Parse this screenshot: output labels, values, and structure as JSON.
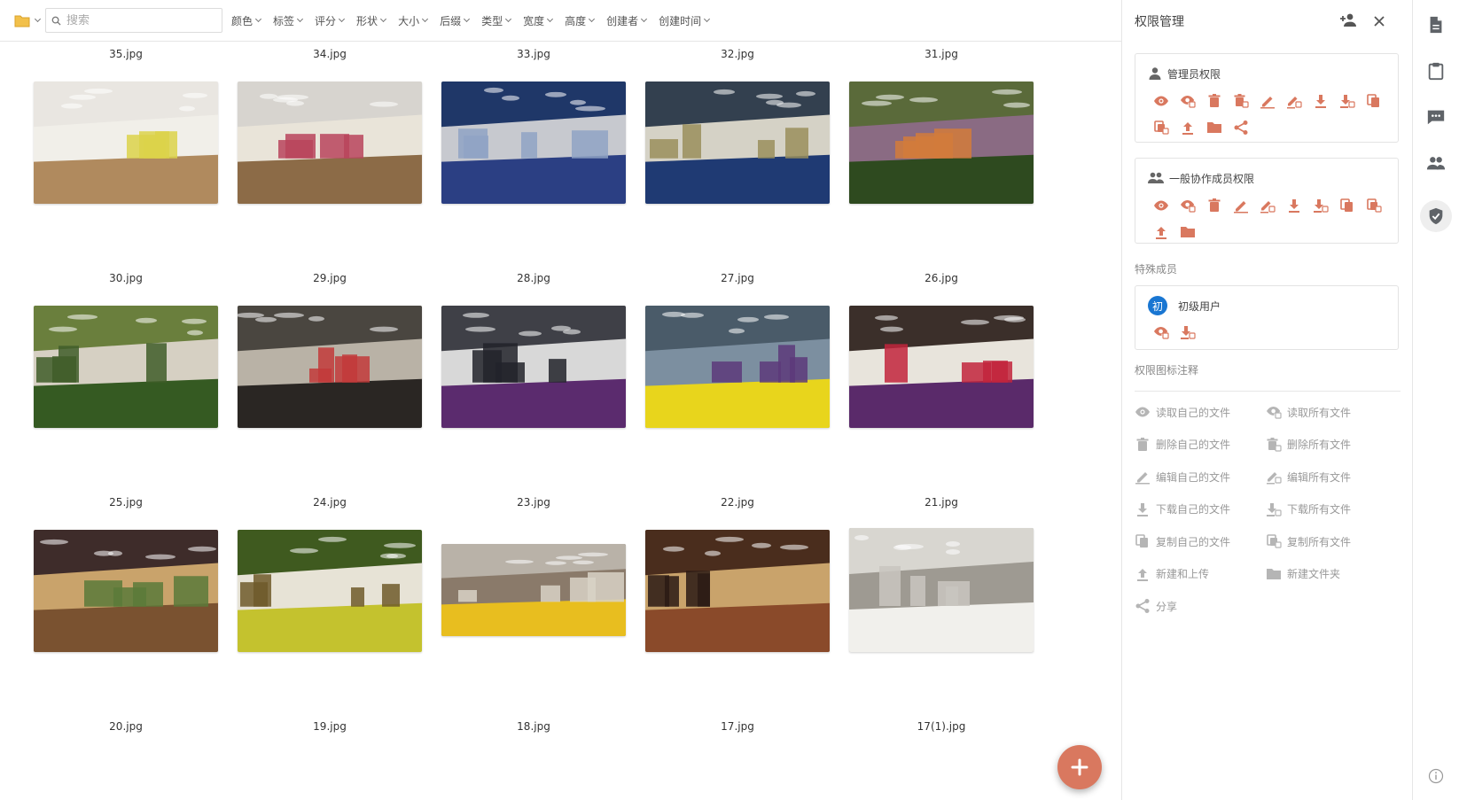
{
  "toolbar": {
    "search_placeholder": "搜索",
    "filters": [
      "颜色",
      "标签",
      "评分",
      "形状",
      "大小",
      "后缀",
      "类型",
      "宽度",
      "高度",
      "创建者",
      "创建时间"
    ]
  },
  "gallery": {
    "top_row_names": [
      "35.jpg",
      "34.jpg",
      "33.jpg",
      "32.jpg",
      "31.jpg"
    ],
    "rows": [
      {
        "items": [
          {
            "name": "30.jpg",
            "colors": [
              "#e9e6e1",
              "#b08a5e",
              "#f1efe9",
              "#dcd24a"
            ]
          },
          {
            "name": "29.jpg",
            "colors": [
              "#d7d4cf",
              "#8c6b47",
              "#e9e4d9",
              "#b8445c"
            ]
          },
          {
            "name": "28.jpg",
            "colors": [
              "#1f3768",
              "#2b3f83",
              "#c7c9cf",
              "#8fa3c4"
            ]
          },
          {
            "name": "27.jpg",
            "colors": [
              "#33404f",
              "#1f3a73",
              "#d5d2c6",
              "#9a8f5c"
            ]
          },
          {
            "name": "26.jpg",
            "colors": [
              "#5a6a3a",
              "#2e4a1f",
              "#8a6b83",
              "#d27b3b"
            ]
          }
        ]
      },
      {
        "items": [
          {
            "name": "25.jpg",
            "colors": [
              "#6a7f3d",
              "#355a22",
              "#d6d0c3",
              "#3f5d29"
            ]
          },
          {
            "name": "24.jpg",
            "colors": [
              "#4a4640",
              "#2a2623",
              "#b9b2a6",
              "#c23a3a"
            ]
          },
          {
            "name": "23.jpg",
            "colors": [
              "#3f4047",
              "#5b2b6e",
              "#d8d8d8",
              "#22232a"
            ]
          },
          {
            "name": "22.jpg",
            "colors": [
              "#4a5b69",
              "#e8d51c",
              "#7c8fa0",
              "#5d3a7a"
            ]
          },
          {
            "name": "21.jpg",
            "colors": [
              "#3b2f2a",
              "#5a2a6a",
              "#e8e4dc",
              "#c2243c"
            ]
          }
        ]
      },
      {
        "items": [
          {
            "name": "20.jpg",
            "colors": [
              "#3e2c2a",
              "#7a5230",
              "#c9a36b",
              "#5b7a3a"
            ]
          },
          {
            "name": "19.jpg",
            "colors": [
              "#3f5a1f",
              "#c4c22e",
              "#e7e3d6",
              "#6f5a2a"
            ]
          },
          {
            "name": "18.jpg",
            "colors": [
              "#b9b2a8",
              "#e8be1f",
              "#8a7a6a",
              "#d8d2c6"
            ]
          },
          {
            "name": "17.jpg",
            "colors": [
              "#4a2d1d",
              "#8a4a2a",
              "#c9a36b",
              "#2a1a14"
            ]
          },
          {
            "name": "17(1).jpg",
            "colors": [
              "#d8d6d0",
              "#f1f0ec",
              "#9e9a92",
              "#c9c6bf"
            ]
          }
        ]
      }
    ]
  },
  "panel": {
    "title": "权限管理",
    "admin": {
      "title": "管理员权限",
      "icons": [
        "eye-icon",
        "eye-all-icon",
        "trash-icon",
        "trash-all-icon",
        "pencil-icon",
        "pencil-all-icon",
        "download-icon",
        "download-all-icon",
        "copy-icon",
        "copy-all-icon",
        "upload-icon",
        "folder-icon",
        "share-icon"
      ]
    },
    "member": {
      "title": "一般协作成员权限",
      "icons": [
        "eye-icon",
        "eye-all-icon",
        "trash-icon",
        "pencil-icon",
        "pencil-all-icon",
        "download-icon",
        "download-all-icon",
        "copy-icon",
        "copy-all-icon",
        "upload-icon",
        "folder-icon"
      ]
    },
    "special_label": "特殊成员",
    "special_member": {
      "avatar_char": "初",
      "name": "初级用户",
      "icons": [
        "eye-all-icon",
        "download-all-icon"
      ]
    },
    "legend_label": "权限图标注释",
    "legend": [
      {
        "icon": "eye-icon",
        "label": "读取自己的文件"
      },
      {
        "icon": "eye-all-icon",
        "label": "读取所有文件"
      },
      {
        "icon": "trash-icon",
        "label": "删除自己的文件"
      },
      {
        "icon": "trash-all-icon",
        "label": "删除所有文件"
      },
      {
        "icon": "pencil-icon",
        "label": "编辑自己的文件"
      },
      {
        "icon": "pencil-all-icon",
        "label": "编辑所有文件"
      },
      {
        "icon": "download-icon",
        "label": "下载自己的文件"
      },
      {
        "icon": "download-all-icon",
        "label": "下载所有文件"
      },
      {
        "icon": "copy-icon",
        "label": "复制自己的文件"
      },
      {
        "icon": "copy-all-icon",
        "label": "复制所有文件"
      },
      {
        "icon": "upload-icon",
        "label": "新建和上传"
      },
      {
        "icon": "folder-icon",
        "label": "新建文件夹"
      },
      {
        "icon": "share-icon",
        "label": "分享"
      }
    ]
  },
  "rail": {
    "items": [
      "document-icon",
      "clipboard-icon",
      "comment-icon",
      "people-icon",
      "shield-check-icon"
    ],
    "active": "shield-check-icon"
  },
  "colors": {
    "accent": "#d9785f",
    "rail_icon": "#5f6368",
    "legend_icon": "#b5b5b5",
    "folder": "#f2c04a",
    "avatar": "#1976d2"
  }
}
